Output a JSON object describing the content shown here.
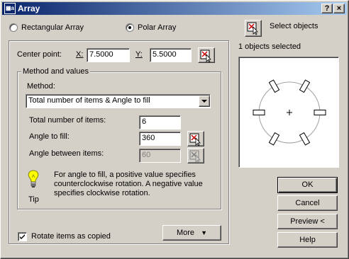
{
  "window": {
    "title": "Array",
    "icon_text": "▦a",
    "help_button": "?",
    "close_button": "×"
  },
  "array_type": {
    "rectangular_label": "Rectangular Array",
    "polar_label": "Polar Array",
    "selected": "polar"
  },
  "select_objects": {
    "label": "Select objects",
    "status": "1 objects selected"
  },
  "center_point": {
    "label": "Center point:",
    "x_label": "X:",
    "x_value": "7.5000",
    "y_label": "Y:",
    "y_value": "5.5000"
  },
  "method_group": {
    "caption": "Method and values",
    "method_label": "Method:",
    "method_value": "Total number of items & Angle to fill"
  },
  "fields": {
    "total_items_label": "Total number of items:",
    "total_items_value": "6",
    "angle_fill_label": "Angle to fill:",
    "angle_fill_value": "360",
    "angle_between_label": "Angle between items:",
    "angle_between_value": "60"
  },
  "tip": {
    "label": "Tip",
    "text": "For angle to fill, a positive value specifies counterclockwise rotation.  A negative value specifies clockwise rotation."
  },
  "rotate_items": {
    "label": "Rotate items as copied",
    "checked": true
  },
  "buttons": {
    "more": "More",
    "ok": "OK",
    "cancel": "Cancel",
    "preview": "Preview <",
    "help": "Help"
  },
  "preview": {
    "item_count": 6
  }
}
